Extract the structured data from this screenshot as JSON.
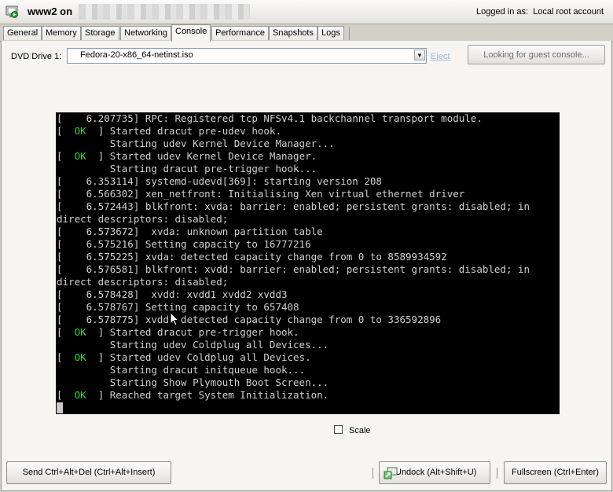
{
  "header": {
    "vm_name": "www2 on",
    "logged_in_label": "Logged in as:",
    "logged_in_user": "Local root account"
  },
  "tabs": [
    {
      "label": "General",
      "active": false
    },
    {
      "label": "Memory",
      "active": false
    },
    {
      "label": "Storage",
      "active": false
    },
    {
      "label": "Networking",
      "active": false
    },
    {
      "label": "Console",
      "active": true
    },
    {
      "label": "Performance",
      "active": false
    },
    {
      "label": "Snapshots",
      "active": false
    },
    {
      "label": "Logs",
      "active": false
    }
  ],
  "dvd": {
    "label": "DVD Drive 1:",
    "selected": "Fedora-20-x86_64-netinst.iso",
    "eject_label": "Eject"
  },
  "guest_console_button": "Looking for guest console...",
  "console": {
    "lines": [
      {
        "text": "[    6.207735] RPC: Registered tcp NFSv4.1 backchannel transport module."
      },
      {
        "ok": true,
        "text": " ] Started dracut pre-udev hook."
      },
      {
        "text": "         Starting udev Kernel Device Manager..."
      },
      {
        "ok": true,
        "text": " ] Started udev Kernel Device Manager."
      },
      {
        "text": "         Starting dracut pre-trigger hook..."
      },
      {
        "text": "[    6.353114] systemd-udevd[369]: starting version 208"
      },
      {
        "text": "[    6.566302] xen_netfront: Initialising Xen virtual ethernet driver"
      },
      {
        "text": "[    6.572443] blkfront: xvda: barrier: enabled; persistent grants: disabled; in"
      },
      {
        "text": "direct descriptors: disabled;"
      },
      {
        "text": "[    6.573672]  xvda: unknown partition table"
      },
      {
        "text": "[    6.575216] Setting capacity to 16777216"
      },
      {
        "text": "[    6.575225] xvda: detected capacity change from 0 to 8589934592"
      },
      {
        "text": "[    6.576581] blkfront: xvdd: barrier: enabled; persistent grants: disabled; in"
      },
      {
        "text": "direct descriptors: disabled;"
      },
      {
        "text": "[    6.578428]  xvdd: xvdd1 xvdd2 xvdd3"
      },
      {
        "text": "[    6.578767] Setting capacity to 657408"
      },
      {
        "text": "[    6.578775] xvdd: detected capacity change from 0 to 336592896"
      },
      {
        "ok": true,
        "text": " ] Started dracut pre-trigger hook."
      },
      {
        "text": "         Starting udev Coldplug all Devices..."
      },
      {
        "ok": true,
        "text": " ] Started udev Coldplug all Devices."
      },
      {
        "text": "         Starting dracut initqueue hook..."
      },
      {
        "text": "         Starting Show Plymouth Boot Screen..."
      },
      {
        "ok": true,
        "text": " ] Reached target System Initialization."
      }
    ],
    "ok_tag": "OK",
    "ok_color": "#33d633"
  },
  "bottom": {
    "send_cad": "Send Ctrl+Alt+Del (Ctrl+Alt+Insert)",
    "scale_label": "Scale",
    "scale_checked": false,
    "undock": "Undock (Alt+Shift+U)",
    "fullscreen": "Fullscreen (Ctrl+Enter)"
  }
}
